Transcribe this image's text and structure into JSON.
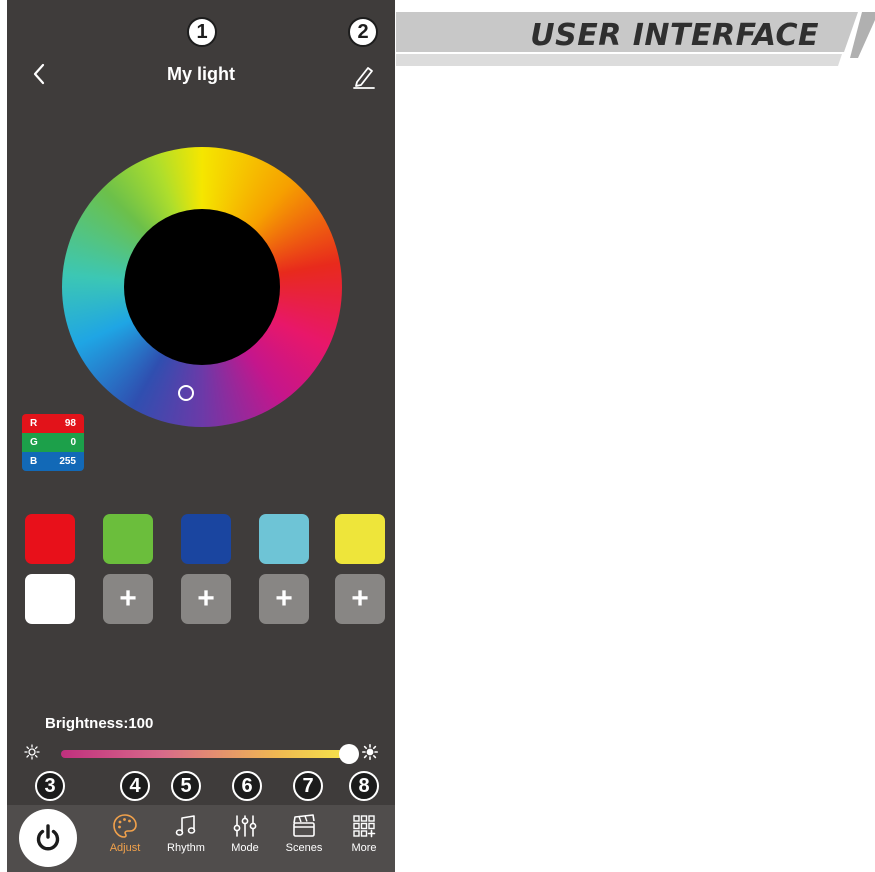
{
  "banner": {
    "title": "USER INTERFACE"
  },
  "header": {
    "title": "My light"
  },
  "callouts": [
    "1",
    "2",
    "3",
    "4",
    "5",
    "6",
    "7",
    "8"
  ],
  "rgb": {
    "r_label": "R",
    "r_value": "98",
    "g_label": "G",
    "g_value": "0",
    "b_label": "B",
    "b_value": "255"
  },
  "swatches": {
    "row1": [
      "#e8101a",
      "#6bbe3c",
      "#1a45a0",
      "#6ec4d6",
      "#eee53a"
    ],
    "white": "#ffffff",
    "add_label": "+"
  },
  "brightness": {
    "label": "Brightness:100",
    "value": 100,
    "max": 100
  },
  "nav": {
    "tabs": [
      {
        "label": "Adjust",
        "icon": "palette-icon",
        "active": true
      },
      {
        "label": "Rhythm",
        "icon": "music-note-icon",
        "active": false
      },
      {
        "label": "Mode",
        "icon": "sliders-icon",
        "active": false
      },
      {
        "label": "Scenes",
        "icon": "clapperboard-icon",
        "active": false
      },
      {
        "label": "More",
        "icon": "grid-icon",
        "active": false
      }
    ],
    "power_icon": "power-icon"
  },
  "colors": {
    "screen_bg": "#3f3c3b",
    "nav_bg": "#504d4c",
    "active_tab": "#f1a14b"
  }
}
